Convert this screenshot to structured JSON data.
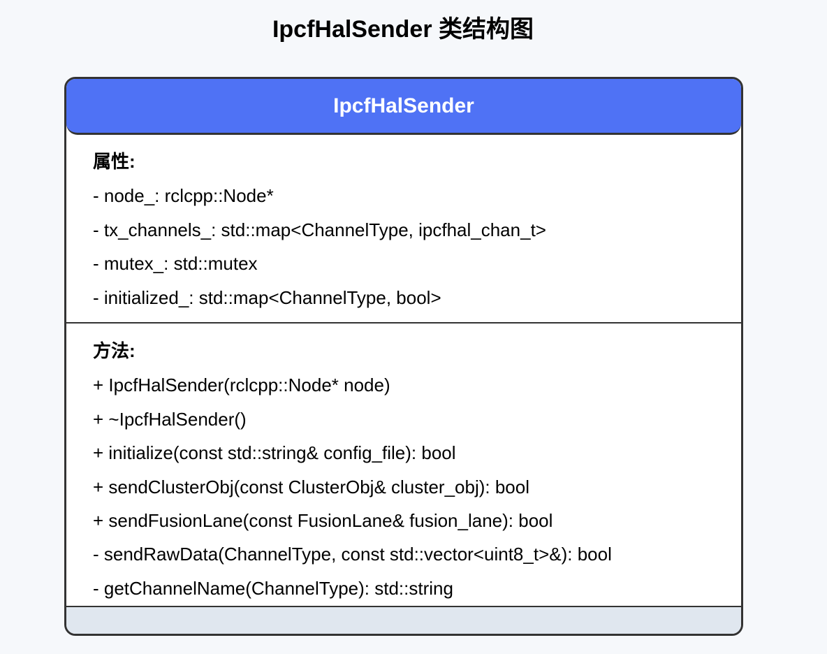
{
  "title": "IpcfHalSender 类结构图",
  "class": {
    "name": "IpcfHalSender",
    "header_color": "#4f72f5",
    "attributes_heading": "属性:",
    "attributes": [
      "- node_: rclcpp::Node*",
      "- tx_channels_: std::map<ChannelType, ipcfhal_chan_t>",
      "- mutex_: std::mutex",
      "- initialized_: std::map<ChannelType, bool>"
    ],
    "methods_heading": "方法:",
    "methods": [
      "+ IpcfHalSender(rclcpp::Node* node)",
      "+ ~IpcfHalSender()",
      "+ initialize(const std::string& config_file): bool",
      "+ sendClusterObj(const ClusterObj& cluster_obj): bool",
      "+ sendFusionLane(const FusionLane& fusion_lane): bool",
      "- sendRawData(ChannelType, const std::vector<uint8_t>&): bool",
      "- getChannelName(ChannelType): std::string"
    ]
  }
}
